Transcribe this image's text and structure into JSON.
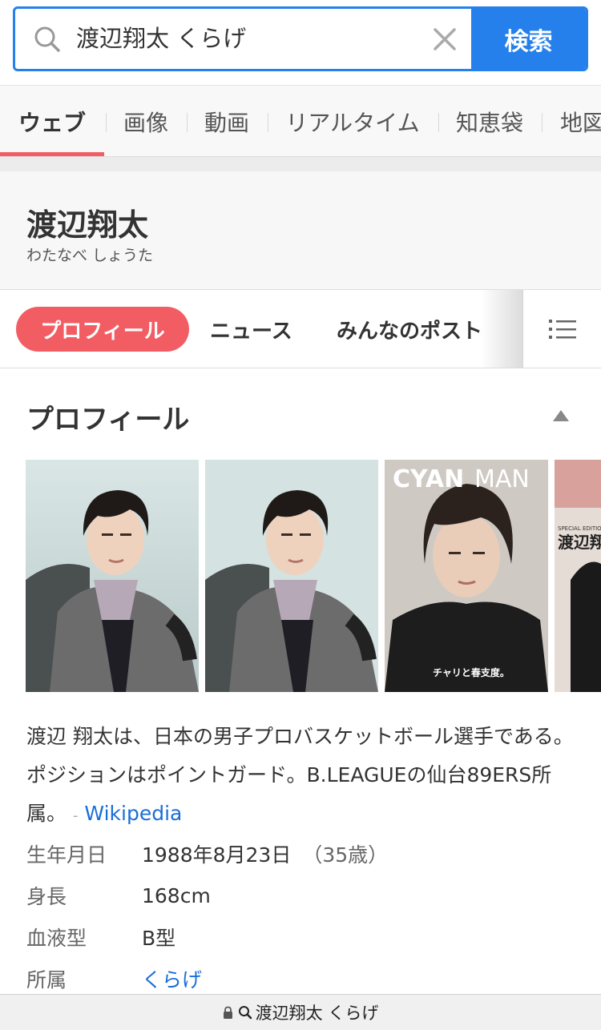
{
  "search": {
    "query": "渡辺翔太 くらげ",
    "button_label": "検索"
  },
  "tabs": [
    "ウェブ",
    "画像",
    "動画",
    "リアルタイム",
    "知恵袋",
    "地図"
  ],
  "active_tab": "ウェブ",
  "knowledge": {
    "title": "渡辺翔太",
    "reading": "わたなべ しょうた",
    "subtabs": [
      "プロフィール",
      "ニュース",
      "みんなのポスト"
    ],
    "section_title": "プロフィール",
    "images": [
      {
        "alt": "portrait-1"
      },
      {
        "alt": "portrait-2"
      },
      {
        "alt": "CYANMAN magazine cover",
        "cover_title_bold": "CYAN",
        "cover_title_light": "MAN",
        "cover_caption": "チャリと春支度。"
      },
      {
        "alt": "magazine cover",
        "cover_text": "渡辺翔",
        "cover_sub": "SPECIAL EDITION"
      }
    ],
    "description": "渡辺 翔太は、日本の男子プロバスケットボール選手である。ポジションはポイントガード。B.LEAGUEの仙台89ERS所属。",
    "source_sep": "-",
    "source_label": "Wikipedia",
    "facts": [
      {
        "label": "生年月日",
        "value": "1988年8月23日",
        "extra": "（35歳）"
      },
      {
        "label": "身長",
        "value": "168cm",
        "extra": ""
      },
      {
        "label": "血液型",
        "value": "B型",
        "extra": ""
      },
      {
        "label": "所属",
        "value": "くらげ",
        "extra": "",
        "link": true
      }
    ]
  },
  "urlbar": {
    "text": "渡辺翔太 くらげ"
  },
  "colors": {
    "accent_blue": "#2680eb",
    "accent_red": "#f25d63",
    "link_blue": "#1a6ed8"
  }
}
